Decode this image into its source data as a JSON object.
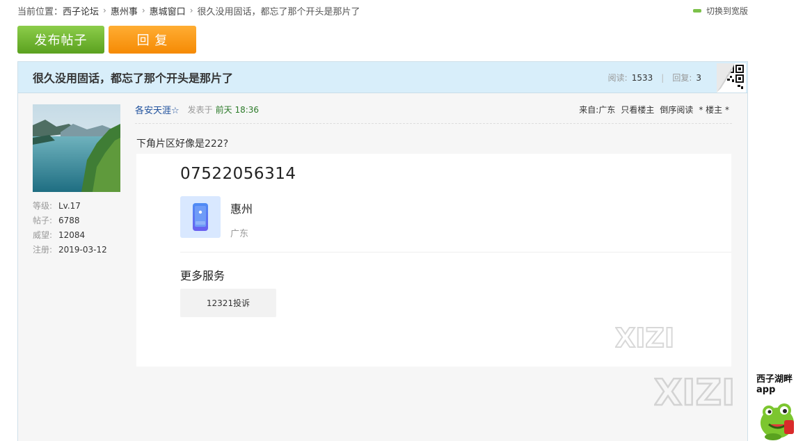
{
  "breadcrumb": {
    "prefix": "当前位置：",
    "items": [
      "西子论坛",
      "惠州事",
      "惠城窗口"
    ],
    "current": "很久没用固话，都忘了那个开头是那片了"
  },
  "header_right": {
    "switch_label": "切换到宽版"
  },
  "actions": {
    "post_label": "发布帖子",
    "reply_label": "回 复"
  },
  "thread": {
    "title": "很久没用固话，都忘了那个开头是那片了",
    "views_label": "阅读:",
    "views": "1533",
    "replies_label": "回复:",
    "replies": "3"
  },
  "author": {
    "name": "各安天涯☆",
    "level_label": "等级:",
    "level": "Lv.17",
    "posts_label": "帖子:",
    "posts": "6788",
    "prestige_label": "威望:",
    "prestige": "12084",
    "joined_label": "注册:",
    "joined": "2019-03-12"
  },
  "post": {
    "posted_label": "发表于",
    "time": "前天 18:36",
    "from": "来自:广东",
    "only_op": "只看楼主",
    "reverse": "倒序阅读",
    "floor": "* 楼主 *",
    "text": "下角片区好像是222?"
  },
  "embed": {
    "phone_number": "07522056314",
    "city": "惠州",
    "province": "广东",
    "more_services": "更多服务",
    "service_button": "12321投诉"
  },
  "watermark": {
    "text": "XIZI"
  },
  "app_logo": {
    "line1": "西子湖畔",
    "line2": "app"
  },
  "colors": {
    "post_button": "#6fb536",
    "reply_button": "#f7940d",
    "title_bar": "#d8eefa",
    "author_link": "#1d4f9c",
    "time_green": "#2b7a28"
  }
}
